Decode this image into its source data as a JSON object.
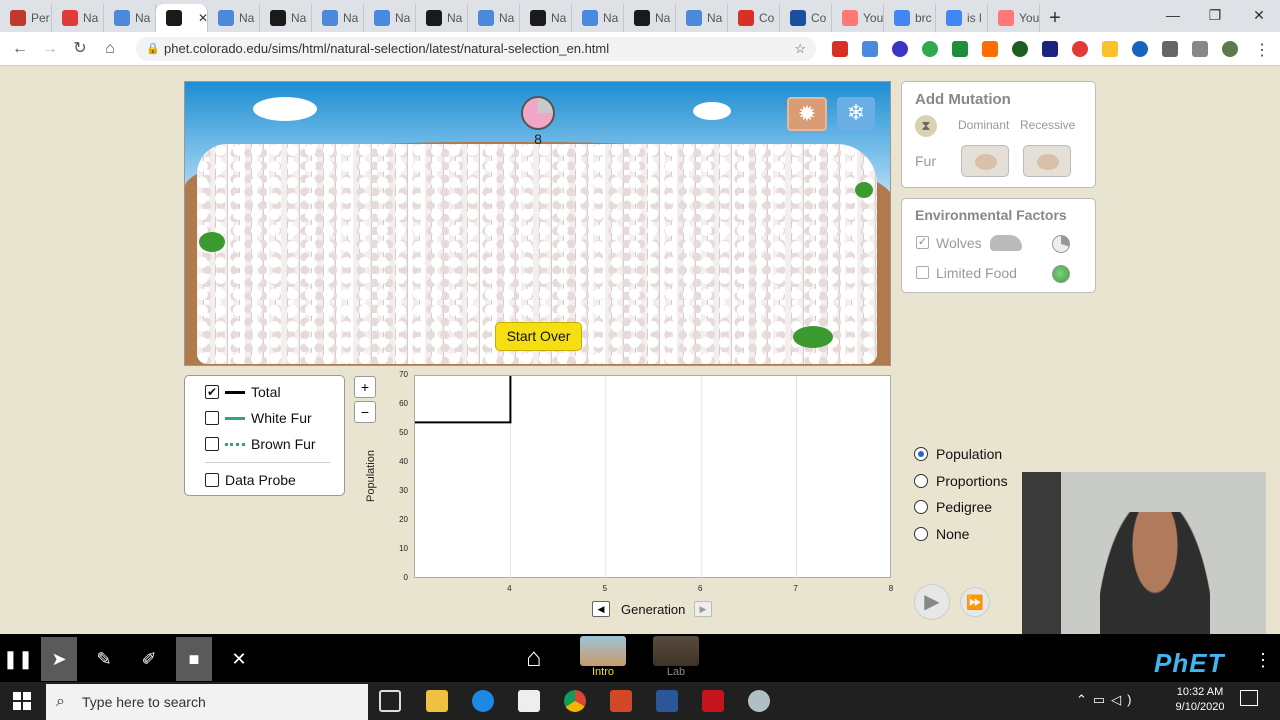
{
  "browser": {
    "tabs": [
      {
        "label": "Per",
        "color": "#c0392b"
      },
      {
        "label": "Na",
        "color": "#e03b3b"
      },
      {
        "label": "Na",
        "color": "#4a89dc"
      },
      {
        "label": "",
        "color": "#1a1a1a",
        "active": true
      },
      {
        "label": "Na",
        "color": "#4a89dc"
      },
      {
        "label": "Na",
        "color": "#1a1a1a"
      },
      {
        "label": "Na",
        "color": "#4a89dc"
      },
      {
        "label": "Na",
        "color": "#4a89dc"
      },
      {
        "label": "Na",
        "color": "#1a1a1a"
      },
      {
        "label": "Na",
        "color": "#4a89dc"
      },
      {
        "label": "Na",
        "color": "#1a1a1a"
      },
      {
        "label": "Na",
        "color": "#4a89dc"
      },
      {
        "label": "Na",
        "color": "#1a1a1a"
      },
      {
        "label": "Na",
        "color": "#4a89dc"
      },
      {
        "label": "Co",
        "color": "#d93025"
      },
      {
        "label": "Co",
        "color": "#1a4fa0"
      },
      {
        "label": "You",
        "color": "#ff7777"
      },
      {
        "label": "brc",
        "color": "#4285f4"
      },
      {
        "label": "is l",
        "color": "#4285f4"
      },
      {
        "label": "You",
        "color": "#ff7777"
      }
    ],
    "url": "phet.colorado.edu/sims/html/natural-selection/latest/natural-selection_en.html",
    "new_tab": "+",
    "close_tab": "✕",
    "minimize": "—",
    "maximize": "❐",
    "close": "✕"
  },
  "sim": {
    "generation_number": "8",
    "start_over": "Start Over",
    "add_mutation": {
      "title": "Add Mutation",
      "dominant": "Dominant",
      "recessive": "Recessive",
      "fur_label": "Fur"
    },
    "environmental_factors": {
      "title": "Environmental Factors",
      "wolves": "Wolves",
      "wolves_checked": true,
      "limited_food": "Limited Food",
      "limited_food_checked": false
    },
    "legend": {
      "total": "Total",
      "white_fur": "White Fur",
      "brown_fur": "Brown Fur",
      "data_probe": "Data Probe",
      "total_color": "#000000",
      "white_color": "#2aa876",
      "brown_color": "#2aa876"
    },
    "zoom": {
      "in": "+",
      "out": "−"
    },
    "graph": {
      "ylabel": "Population",
      "xlabel": "Generation",
      "yticks": [
        "70",
        "60",
        "50",
        "40",
        "30",
        "20",
        "10",
        "0"
      ],
      "xticks": [
        "4",
        "5",
        "6",
        "7",
        "8"
      ]
    },
    "view_options": [
      {
        "label": "Population",
        "selected": true
      },
      {
        "label": "Proportions",
        "selected": false
      },
      {
        "label": "Pedigree",
        "selected": false
      },
      {
        "label": "None",
        "selected": false
      }
    ],
    "screens": [
      {
        "label": "Intro"
      },
      {
        "label": "Lab"
      }
    ],
    "brand": "PhET"
  },
  "chart_data": {
    "type": "line",
    "xlabel": "Generation",
    "ylabel": "Population",
    "xlim": [
      3,
      8
    ],
    "ylim": [
      0,
      70
    ],
    "series": [
      {
        "name": "Total",
        "x": [
          3,
          4,
          4
        ],
        "y": [
          54,
          54,
          70
        ]
      }
    ]
  },
  "taskbar": {
    "search_placeholder": "Type here to search",
    "time": "10:32 AM",
    "date": "9/10/2020"
  }
}
